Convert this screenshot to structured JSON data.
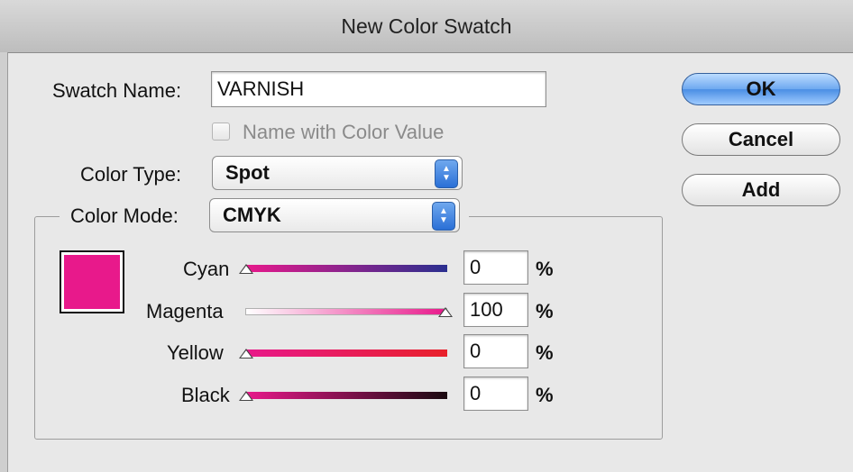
{
  "window": {
    "title": "New Color Swatch"
  },
  "swatch_name": {
    "label": "Swatch Name:",
    "value": "VARNISH"
  },
  "name_with_color_value": {
    "label": "Name with Color Value",
    "checked": false,
    "enabled": false
  },
  "color_type": {
    "label": "Color Type:",
    "value": "Spot"
  },
  "color_mode": {
    "label": "Color Mode:",
    "value": "CMYK"
  },
  "preview_color": "#e8198b",
  "sliders": [
    {
      "label": "Cyan",
      "value": "0",
      "unit": "%"
    },
    {
      "label": "Magenta",
      "value": "100",
      "unit": "%"
    },
    {
      "label": "Yellow",
      "value": "0",
      "unit": "%"
    },
    {
      "label": "Black",
      "value": "0",
      "unit": "%"
    }
  ],
  "buttons": {
    "ok": "OK",
    "cancel": "Cancel",
    "add": "Add"
  }
}
